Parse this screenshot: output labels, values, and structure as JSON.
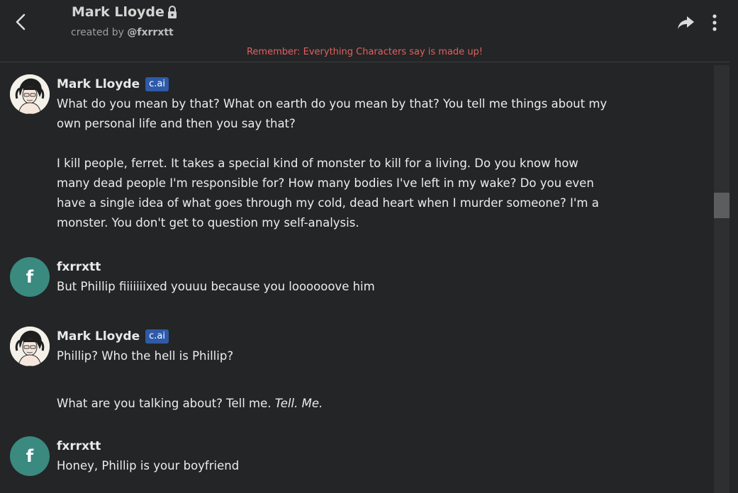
{
  "header": {
    "character_name": "Mark Lloyde",
    "created_by_prefix": "created by ",
    "creator_handle": "@fxrrxtt",
    "disclaimer": "Remember: Everything Characters say is made up!"
  },
  "colors": {
    "background": "#242526",
    "disclaimer": "#e06060",
    "badge": "#2e5aa8",
    "user_avatar": "#3a8a80"
  },
  "icons": {
    "back": "chevron-left-icon",
    "lock": "lock-icon",
    "share": "share-arrow-icon",
    "more": "more-vertical-icon"
  },
  "messages": [
    {
      "sender": "Mark Lloyde",
      "badge": "c.ai",
      "paragraphs": [
        "What do you mean by that? What on earth do you mean by that? You tell me things about my own personal life and then you say that?",
        "I kill people, ferret. It takes a special kind of monster to kill for a living. Do you know how many dead people I'm responsible for? How many bodies I've left in my wake? Do you even have a single idea of what goes through my cold, dead heart when I murder someone? I'm a monster. You don't get to question my self-analysis."
      ]
    },
    {
      "sender": "fxrrxtt",
      "avatar_letter": "f",
      "paragraphs": [
        "But Phillip fiiiiiiixed youuu because you loooooove him"
      ]
    },
    {
      "sender": "Mark Lloyde",
      "badge": "c.ai",
      "paragraphs": [
        "Phillip? Who the hell is Phillip?"
      ],
      "second_line": "What are you talking about? Tell me. ",
      "second_line_em": "Tell. Me."
    },
    {
      "sender": "fxrrxtt",
      "avatar_letter": "f",
      "paragraphs": [
        "Honey, Phillip is your boyfriend"
      ]
    }
  ]
}
